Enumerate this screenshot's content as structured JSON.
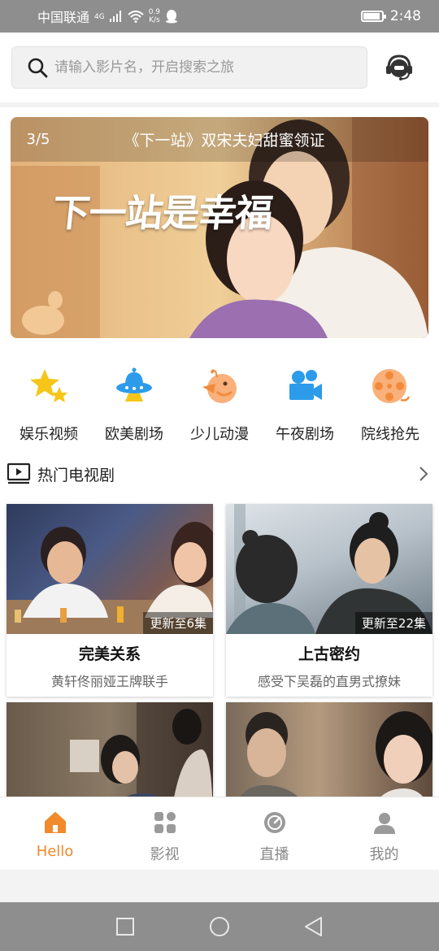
{
  "status_bar": {
    "carrier": "中国联通",
    "network": "4G",
    "speed_value": "0.9",
    "speed_unit": "K/s",
    "time": "2:48",
    "battery_level": 0.85
  },
  "search": {
    "placeholder": "请输入影片名，开启搜索之旅"
  },
  "banner": {
    "counter": "3/5",
    "title": "《下一站》双宋夫妇甜蜜领证",
    "art_title": "下一站是幸福"
  },
  "categories": [
    {
      "label": "娱乐视频",
      "icon": "stars-icon"
    },
    {
      "label": "欧美剧场",
      "icon": "ufo-icon"
    },
    {
      "label": "少儿动漫",
      "icon": "bird-icon"
    },
    {
      "label": "午夜剧场",
      "icon": "camera-icon"
    },
    {
      "label": "院线抢先",
      "icon": "film-reel-icon"
    }
  ],
  "section": {
    "title": "热门电视剧"
  },
  "cards": [
    {
      "title": "完美关系",
      "desc": "黄轩佟丽娅王牌联手",
      "badge": "更新至6集"
    },
    {
      "title": "上古密约",
      "desc": "感受下吴磊的直男式撩妹",
      "badge": "更新至22集"
    },
    {
      "title": "",
      "desc": "",
      "badge": ""
    },
    {
      "title": "",
      "desc": "",
      "badge": ""
    }
  ],
  "bottom_nav": [
    {
      "label": "Hello",
      "icon": "home-icon",
      "active": true
    },
    {
      "label": "影视",
      "icon": "grid-icon",
      "active": false
    },
    {
      "label": "直播",
      "icon": "live-icon",
      "active": false
    },
    {
      "label": "我的",
      "icon": "profile-icon",
      "active": false
    }
  ],
  "colors": {
    "accent": "#f08a2c",
    "icon_yellow": "#f5c518",
    "icon_blue": "#2c9bea",
    "icon_orange": "#f28a3c",
    "inactive": "#9a9a9a"
  }
}
